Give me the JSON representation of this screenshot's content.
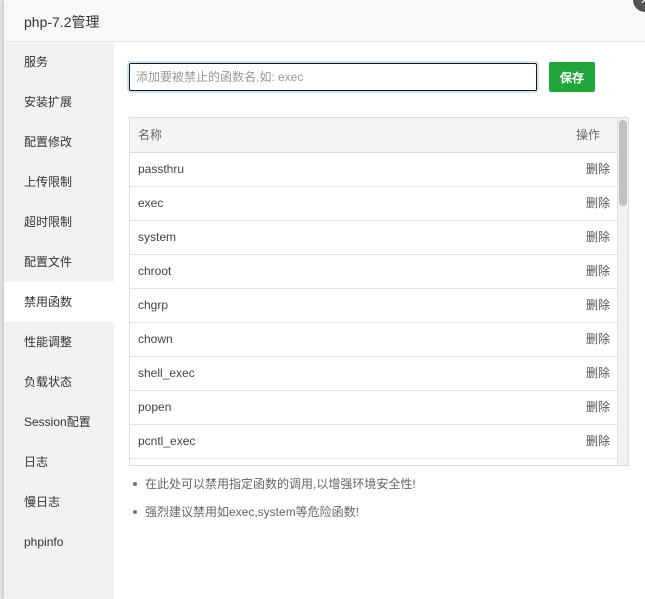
{
  "window": {
    "title": "php-7.2管理",
    "close_label": "×"
  },
  "sidebar": {
    "items": [
      {
        "label": "服务"
      },
      {
        "label": "安装扩展"
      },
      {
        "label": "配置修改"
      },
      {
        "label": "上传限制"
      },
      {
        "label": "超时限制"
      },
      {
        "label": "配置文件"
      },
      {
        "label": "禁用函数",
        "active": true
      },
      {
        "label": "性能调整"
      },
      {
        "label": "负载状态"
      },
      {
        "label": "Session配置"
      },
      {
        "label": "日志"
      },
      {
        "label": "慢日志"
      },
      {
        "label": "phpinfo"
      }
    ]
  },
  "form": {
    "input_value": "",
    "input_placeholder": "添加要被禁止的函数名,如: exec",
    "save_label": "保存"
  },
  "table": {
    "headers": {
      "name": "名称",
      "op": "操作"
    },
    "rows": [
      {
        "name": "passthru",
        "op": "删除"
      },
      {
        "name": "exec",
        "op": "删除"
      },
      {
        "name": "system",
        "op": "删除"
      },
      {
        "name": "chroot",
        "op": "删除"
      },
      {
        "name": "chgrp",
        "op": "删除"
      },
      {
        "name": "chown",
        "op": "删除"
      },
      {
        "name": "shell_exec",
        "op": "删除"
      },
      {
        "name": "popen",
        "op": "删除"
      },
      {
        "name": "pcntl_exec",
        "op": "删除"
      }
    ]
  },
  "tips": [
    "在此处可以禁用指定函数的调用,以增强环境安全性!",
    "强烈建议禁用如exec,system等危险函数!"
  ],
  "colors": {
    "accent": "#20a53a",
    "sidebar_bg": "#f2f2f2"
  }
}
